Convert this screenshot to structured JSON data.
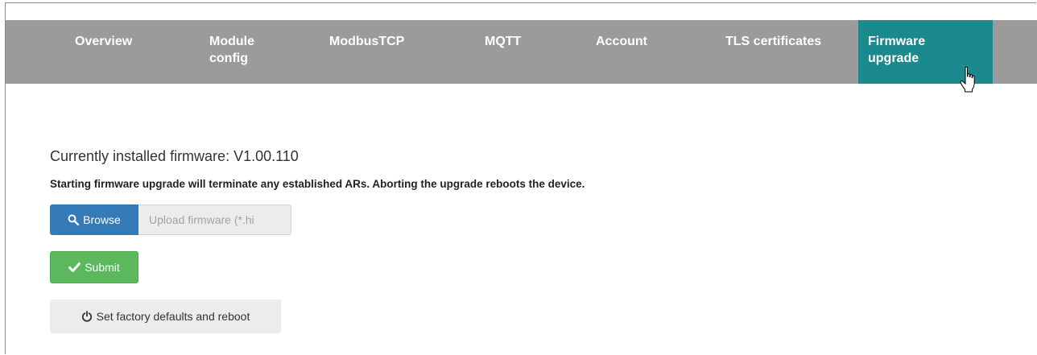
{
  "nav": {
    "items": [
      {
        "id": "overview",
        "label": "Overview"
      },
      {
        "id": "module-config",
        "label": "Module\nconfig"
      },
      {
        "id": "modbustcp",
        "label": "ModbusTCP"
      },
      {
        "id": "mqtt",
        "label": "MQTT"
      },
      {
        "id": "account",
        "label": "Account"
      },
      {
        "id": "tls-certificates",
        "label": "TLS certificates"
      },
      {
        "id": "firmware-upgrade",
        "label": "Firmware\nupgrade",
        "active": true
      }
    ],
    "colors": {
      "bar": "#9b9b9b",
      "active": "#1b8a8e",
      "text": "#ffffff"
    }
  },
  "firmware": {
    "current_label": "Currently installed firmware: V1.00.110",
    "warning": "Starting firmware upgrade will terminate any established ARs. Aborting the upgrade reboots the device.",
    "browse_label": "Browse",
    "browse_icon": "search-icon",
    "upload_placeholder": "Upload firmware (*.hi",
    "submit_label": "Submit",
    "submit_icon": "check-icon",
    "factory_label": "Set factory defaults and reboot",
    "factory_icon": "power-icon"
  },
  "colors": {
    "browse": "#337ab7",
    "submit": "#5cb85c",
    "neutral": "#ececec"
  }
}
